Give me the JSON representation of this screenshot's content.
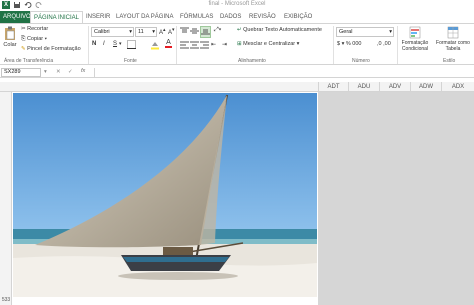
{
  "window": {
    "title": "final - Microsoft Excel"
  },
  "tabs": [
    "ARQUIVO",
    "PÁGINA INICIAL",
    "INSERIR",
    "LAYOUT DA PÁGINA",
    "FÓRMULAS",
    "DADOS",
    "REVISÃO",
    "EXIBIÇÃO"
  ],
  "clipboard": {
    "paste": "Colar",
    "cut": "Recortar",
    "copy": "Copiar",
    "painter": "Pincel de Formatação",
    "label": "Área de Transferência"
  },
  "font": {
    "name": "Calibri",
    "size": "11",
    "label": "Fonte"
  },
  "alignment": {
    "wrap": "Quebrar Texto Automaticamente",
    "merge": "Mesclar e Centralizar",
    "label": "Alinhamento"
  },
  "number": {
    "format": "Geral",
    "label": "Número"
  },
  "styles": {
    "conditional": "Formatação Condicional",
    "table": "Formatar como Tabela",
    "label": "Estilo"
  },
  "formula_bar": {
    "name_box": "SX289",
    "fx": "fx"
  },
  "columns": [
    "ADT",
    "ADU",
    "ADV",
    "ADW",
    "ADX"
  ],
  "row_label": "533",
  "colors": {
    "excel_green": "#217346"
  }
}
